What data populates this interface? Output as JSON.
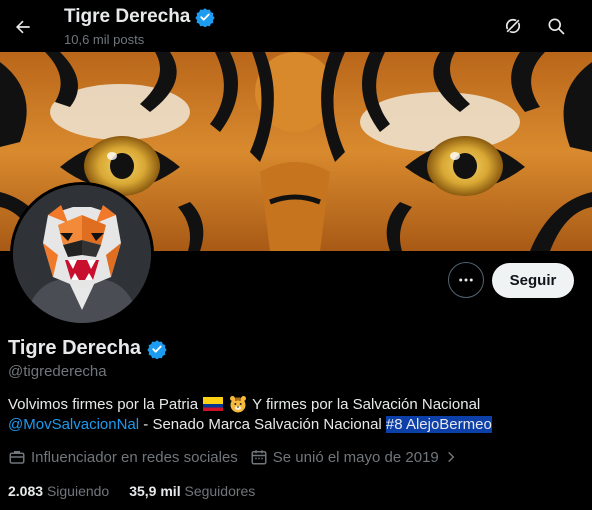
{
  "header": {
    "title": "Tigre Derecha",
    "posts_count": "10,6 mil posts"
  },
  "profile": {
    "name": "Tigre Derecha",
    "handle": "@tigrederecha",
    "follow_label": "Seguir",
    "verified": true,
    "bio": {
      "line1_text": "Volvimos firmes por la Patria",
      "line1_after": "Y firmes por la Salvación Nacional",
      "mention": "@MovSalvacionNal",
      "line2_text": " - Senado Marca Salvación Nacional ",
      "hashtag": "#8 AlejoBermeo"
    },
    "category": "Influenciador en redes sociales",
    "joined": "Se unió el mayo de 2019",
    "following_count": "2.083",
    "following_label": "Siguiendo",
    "followers_count": "35,9 mil",
    "followers_label": "Seguidores"
  },
  "colors": {
    "accent": "#1d9bf0",
    "background": "#000000",
    "text": "#e7e9ea",
    "muted": "#71767b",
    "hashtag_highlight": "#0c3fa8"
  },
  "icons": {
    "back": "arrow-left-icon",
    "grok": "grok-icon",
    "search": "search-icon",
    "more": "more-dots-icon",
    "verified": "verified-badge-icon",
    "category": "briefcase-icon",
    "joined": "calendar-icon",
    "chevron": "chevron-right-icon"
  }
}
